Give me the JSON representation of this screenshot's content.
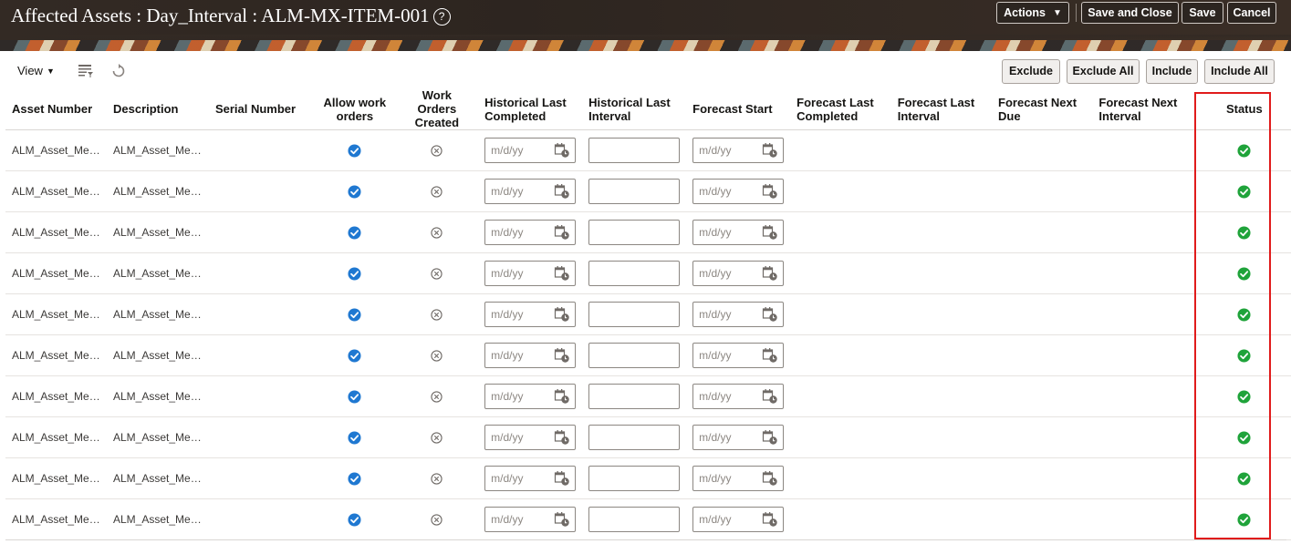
{
  "header": {
    "title": "Affected Assets : Day_Interval : ALM-MX-ITEM-001",
    "help_symbol": "?",
    "actions_label": "Actions",
    "save_close_label": "Save and Close",
    "save_label": "Save",
    "cancel_label": "Cancel"
  },
  "toolbar": {
    "view_label": "View",
    "exclude_label": "Exclude",
    "exclude_all_label": "Exclude All",
    "include_label": "Include",
    "include_all_label": "Include All"
  },
  "columns": [
    "Asset Number",
    "Description",
    "Serial Number",
    "Allow work orders",
    "Work Orders Created",
    "Historical Last Completed",
    "Historical Last Interval",
    "Forecast Start",
    "Forecast Last Completed",
    "Forecast Last Interval",
    "Forecast Next Due",
    "Forecast Next Interval",
    "Status"
  ],
  "date_placeholder": "m/d/yy",
  "rows": [
    {
      "asset_number": "ALM_Asset_Me…",
      "description": "ALM_Asset_Me…",
      "serial_number": "",
      "allow_work_orders": true,
      "work_orders_created": false,
      "status": "success"
    },
    {
      "asset_number": "ALM_Asset_Me…",
      "description": "ALM_Asset_Me…",
      "serial_number": "",
      "allow_work_orders": true,
      "work_orders_created": false,
      "status": "success"
    },
    {
      "asset_number": "ALM_Asset_Me…",
      "description": "ALM_Asset_Me…",
      "serial_number": "",
      "allow_work_orders": true,
      "work_orders_created": false,
      "status": "success"
    },
    {
      "asset_number": "ALM_Asset_Me…",
      "description": "ALM_Asset_Me…",
      "serial_number": "",
      "allow_work_orders": true,
      "work_orders_created": false,
      "status": "success"
    },
    {
      "asset_number": "ALM_Asset_Me…",
      "description": "ALM_Asset_Me…",
      "serial_number": "",
      "allow_work_orders": true,
      "work_orders_created": false,
      "status": "success"
    },
    {
      "asset_number": "ALM_Asset_Me…",
      "description": "ALM_Asset_Me…",
      "serial_number": "",
      "allow_work_orders": true,
      "work_orders_created": false,
      "status": "success"
    },
    {
      "asset_number": "ALM_Asset_Me…",
      "description": "ALM_Asset_Me…",
      "serial_number": "",
      "allow_work_orders": true,
      "work_orders_created": false,
      "status": "success"
    },
    {
      "asset_number": "ALM_Asset_Me…",
      "description": "ALM_Asset_Me…",
      "serial_number": "",
      "allow_work_orders": true,
      "work_orders_created": false,
      "status": "success"
    },
    {
      "asset_number": "ALM_Asset_Me…",
      "description": "ALM_Asset_Me…",
      "serial_number": "",
      "allow_work_orders": true,
      "work_orders_created": false,
      "status": "success"
    },
    {
      "asset_number": "ALM_Asset_Me…",
      "description": "ALM_Asset_Me…",
      "serial_number": "",
      "allow_work_orders": true,
      "work_orders_created": false,
      "status": "success"
    }
  ],
  "colors": {
    "check_blue": "#1f78d1",
    "status_green": "#1fa33a",
    "highlight_red": "#e01b1b",
    "header_bg": "#332a24"
  },
  "icons": {
    "allow_work_orders_true": "check-circle-icon",
    "work_orders_created_false": "x-circle-icon",
    "status_success": "success-check-icon",
    "date_picker": "calendar-icon"
  }
}
